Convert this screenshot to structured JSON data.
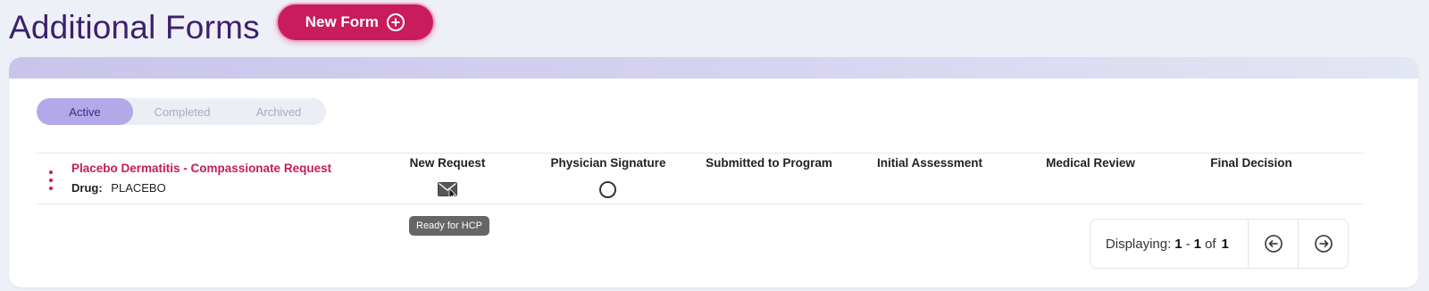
{
  "header": {
    "title": "Additional Forms",
    "new_form_label": "New Form"
  },
  "tabs": [
    {
      "label": "Active",
      "selected": true
    },
    {
      "label": "Completed",
      "selected": false
    },
    {
      "label": "Archived",
      "selected": false
    }
  ],
  "row": {
    "form_name": "Placebo Dermatitis - Compassionate Request",
    "drug_label": "Drug:",
    "drug_value": "PLACEBO",
    "stages": [
      {
        "label": "New Request",
        "status_icon": "envelope-icon"
      },
      {
        "label": "Physician Signature",
        "status_icon": "empty-circle-icon"
      },
      {
        "label": "Submitted to Program"
      },
      {
        "label": "Initial Assessment"
      },
      {
        "label": "Medical Review"
      },
      {
        "label": "Final Decision"
      }
    ],
    "tooltip": "Ready for HCP"
  },
  "pagination": {
    "prefix": "Displaying:",
    "start": "1",
    "dash": "-",
    "end": "1",
    "of_label": "of",
    "total": "1"
  },
  "colors": {
    "accent": "#c91c5c",
    "title": "#3d1f6e",
    "active_tab": "#b3a8e8"
  }
}
